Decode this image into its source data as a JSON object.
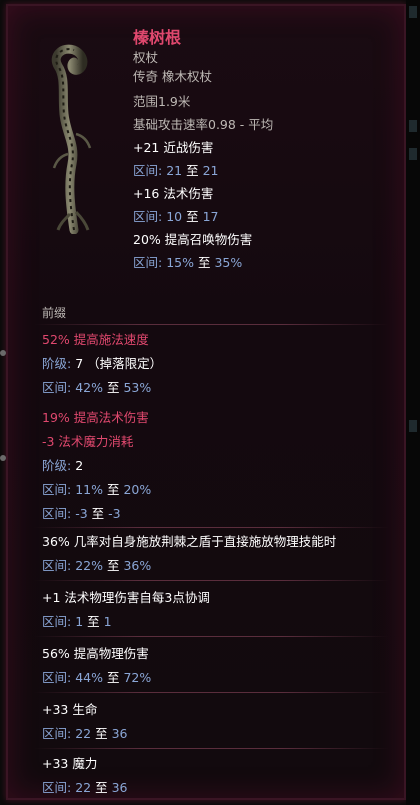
{
  "item": {
    "name": "榛树根",
    "type": "权杖",
    "rarity_base": "传奇 橡木权杖",
    "range": "范围1.9米",
    "attack_speed": "基础攻击速率0.98 - 平均",
    "implicits": [
      {
        "text": "+21 近战伤害",
        "range_label": "区间:",
        "range_low": "21",
        "range_sep": "至",
        "range_high": "21"
      },
      {
        "text": "+16 法术伤害",
        "range_label": "区间:",
        "range_low": "10",
        "range_sep": "至",
        "range_high": "17"
      },
      {
        "text": "20% 提高召唤物伤害",
        "range_label": "区间:",
        "range_low": "15%",
        "range_sep": "至",
        "range_high": "35%"
      }
    ]
  },
  "prefix": {
    "title": "前缀",
    "affix1": {
      "text": "52% 提高施法速度",
      "tier_label": "阶级:",
      "tier_value": "7 （掉落限定）",
      "range_label": "区间:",
      "range_low": "42%",
      "range_sep": "至",
      "range_high": "53%"
    },
    "affix2": {
      "text1": "19% 提高法术伤害",
      "text2": "-3 法术魔力消耗",
      "tier_label": "阶级:",
      "tier_value": "2",
      "range1_label": "区间:",
      "range1_low": "11%",
      "range1_sep": "至",
      "range1_high": "20%",
      "range2_label": "区间:",
      "range2_low": "-3",
      "range2_sep": "至",
      "range2_high": "-3"
    }
  },
  "others": [
    {
      "text": "36% 几率对自身施放荆棘之盾于直接施放物理技能时",
      "range_label": "区间:",
      "range_low": "22%",
      "range_sep": "至",
      "range_high": "36%"
    },
    {
      "text": "+1 法术物理伤害自每3点协调",
      "range_label": "区间:",
      "range_low": "1",
      "range_sep": "至",
      "range_high": "1"
    },
    {
      "text": "56% 提高物理伤害",
      "range_label": "区间:",
      "range_low": "44%",
      "range_sep": "至",
      "range_high": "72%"
    },
    {
      "text": "+33 生命",
      "range_label": "区间:",
      "range_low": "22",
      "range_sep": "至",
      "range_high": "36"
    },
    {
      "text": "+33 魔力",
      "range_label": "区间:",
      "range_low": "22",
      "range_sep": "至",
      "range_high": "36"
    }
  ],
  "colors": {
    "name": "#e0486e",
    "range": "#8aa6d6",
    "text": "#d4d0cc"
  },
  "icons": {
    "item": "twisted-root-scepter-icon"
  }
}
